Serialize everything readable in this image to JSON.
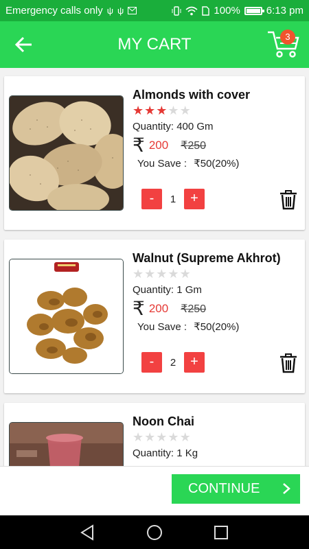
{
  "statusbar": {
    "carrier_text": "Emergency calls only",
    "battery": "100%",
    "time": "6:13 pm"
  },
  "appbar": {
    "title": "MY CART",
    "cart_count": "3"
  },
  "items": [
    {
      "name": "Almonds with cover",
      "rating": 3,
      "stars_total": 5,
      "quantity": "Quantity: 400 Gm",
      "price_symbol": "₹",
      "price": "200",
      "old_price": "₹250",
      "you_save_label": "You Save :",
      "you_save_value": "₹50(20%)",
      "minus_label": "-",
      "plus_label": "+",
      "count": "1"
    },
    {
      "name": "Walnut (Supreme Akhrot)",
      "rating": 0,
      "stars_total": 5,
      "quantity": "Quantity: 1 Gm",
      "price_symbol": "₹",
      "price": "200",
      "old_price": "₹250",
      "you_save_label": "You Save :",
      "you_save_value": "₹50(20%)",
      "minus_label": "-",
      "plus_label": "+",
      "count": "2"
    },
    {
      "name": "Noon Chai",
      "rating": 0,
      "stars_total": 5,
      "quantity": "Quantity: 1 Kg"
    }
  ],
  "footer": {
    "continue_label": "CONTINUE"
  },
  "colors": {
    "primary": "#2ad655",
    "statusbar": "#1aae3b",
    "accent_red": "#e53935",
    "badge": "#f0542d"
  },
  "icons": [
    "back-arrow-icon",
    "cart-icon",
    "star-icon",
    "trash-icon",
    "chevron-right-icon",
    "nav-back-icon",
    "nav-home-icon",
    "nav-recents-icon"
  ]
}
